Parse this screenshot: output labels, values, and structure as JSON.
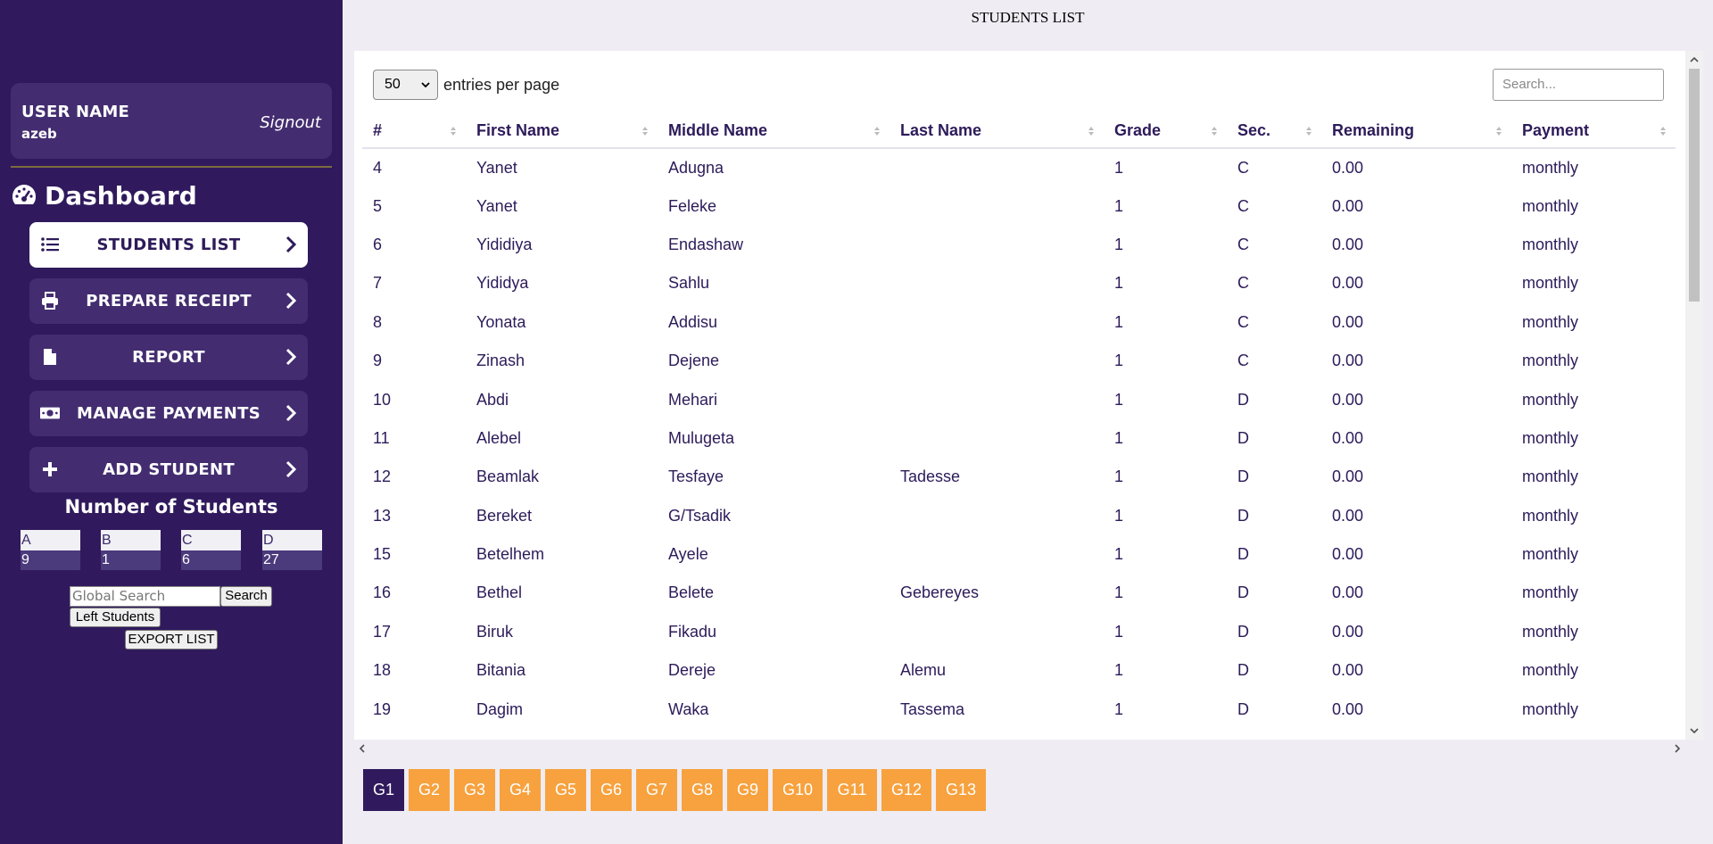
{
  "page_title": "STUDENTS LIST",
  "user": {
    "label": "USER NAME",
    "name": "azeb",
    "signout": "Signout"
  },
  "dashboard_title": "Dashboard",
  "nav": [
    {
      "label": "STUDENTS LIST",
      "icon": "list-icon",
      "active": true
    },
    {
      "label": "PREPARE RECEIPT",
      "icon": "print-icon"
    },
    {
      "label": "REPORT",
      "icon": "file-icon"
    },
    {
      "label": "MANAGE PAYMENTS",
      "icon": "money-icon"
    },
    {
      "label": "ADD STUDENT",
      "icon": "plus-icon"
    }
  ],
  "counts": {
    "title": "Number of Students",
    "sections": [
      {
        "name": "A",
        "value": "9"
      },
      {
        "name": "B",
        "value": "1"
      },
      {
        "name": "C",
        "value": "6"
      },
      {
        "name": "D",
        "value": "27"
      }
    ]
  },
  "global_search": {
    "placeholder": "Global Search",
    "button": "Search"
  },
  "left_students": "Left Students",
  "export": "EXPORT LIST",
  "entries": {
    "value": "50",
    "label": "entries per page"
  },
  "search": {
    "placeholder": "Search..."
  },
  "table": {
    "columns": [
      "#",
      "First Name",
      "Middle Name",
      "Last Name",
      "Grade",
      "Sec.",
      "Remaining",
      "Payment"
    ],
    "rows": [
      [
        "4",
        "Yanet",
        "Adugna",
        "",
        "1",
        "C",
        "0.00",
        "monthly"
      ],
      [
        "5",
        "Yanet",
        "Feleke",
        "",
        "1",
        "C",
        "0.00",
        "monthly"
      ],
      [
        "6",
        "Yididiya",
        "Endashaw",
        "",
        "1",
        "C",
        "0.00",
        "monthly"
      ],
      [
        "7",
        "Yididya",
        "Sahlu",
        "",
        "1",
        "C",
        "0.00",
        "monthly"
      ],
      [
        "8",
        "Yonata",
        "Addisu",
        "",
        "1",
        "C",
        "0.00",
        "monthly"
      ],
      [
        "9",
        "Zinash",
        "Dejene",
        "",
        "1",
        "C",
        "0.00",
        "monthly"
      ],
      [
        "10",
        "Abdi",
        "Mehari",
        "",
        "1",
        "D",
        "0.00",
        "monthly"
      ],
      [
        "11",
        "Alebel",
        "Mulugeta",
        "",
        "1",
        "D",
        "0.00",
        "monthly"
      ],
      [
        "12",
        "Beamlak",
        "Tesfaye",
        "Tadesse",
        "1",
        "D",
        "0.00",
        "monthly"
      ],
      [
        "13",
        "Bereket",
        "G/Tsadik",
        "",
        "1",
        "D",
        "0.00",
        "monthly"
      ],
      [
        "15",
        "Betelhem",
        "Ayele",
        "",
        "1",
        "D",
        "0.00",
        "monthly"
      ],
      [
        "16",
        "Bethel",
        "Belete",
        "Gebereyes",
        "1",
        "D",
        "0.00",
        "monthly"
      ],
      [
        "17",
        "Biruk",
        "Fikadu",
        "",
        "1",
        "D",
        "0.00",
        "monthly"
      ],
      [
        "18",
        "Bitania",
        "Dereje",
        "Alemu",
        "1",
        "D",
        "0.00",
        "monthly"
      ],
      [
        "19",
        "Dagim",
        "Waka",
        "Tassema",
        "1",
        "D",
        "0.00",
        "monthly"
      ]
    ]
  },
  "grades": [
    "G1",
    "G2",
    "G3",
    "G4",
    "G5",
    "G6",
    "G7",
    "G8",
    "G9",
    "G10",
    "G11",
    "G12",
    "G13"
  ],
  "active_grade": "G1",
  "colors": {
    "sidebar": "#301a5d",
    "accent": "#f7a23f",
    "text": "#2d1b5a"
  }
}
